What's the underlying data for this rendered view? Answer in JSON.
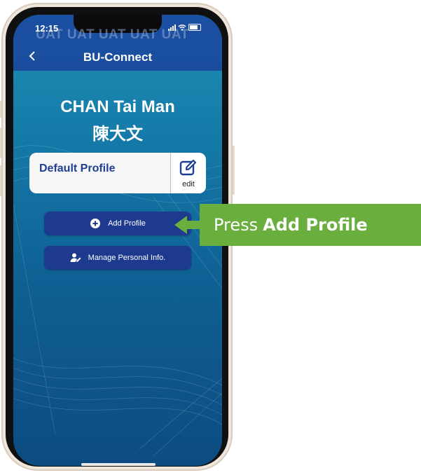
{
  "status_bar": {
    "time": "12:15",
    "watermark": "UAT UAT UAT UAT UAT"
  },
  "header": {
    "back_icon": "chevron-left-icon",
    "title": "BU-Connect"
  },
  "user": {
    "name_en": "CHAN Tai Man",
    "name_zh": "陳大文"
  },
  "profile_card": {
    "name": "Default Profile",
    "edit_label": "edit",
    "edit_icon": "pencil-square-icon"
  },
  "buttons": {
    "add_profile": {
      "label": "Add Profile",
      "icon": "plus-circle-icon"
    },
    "manage_info": {
      "label": "Manage Personal Info.",
      "icon": "user-edit-icon"
    }
  },
  "callout": {
    "prefix": "Press",
    "bold": "Add Profile"
  },
  "colors": {
    "header_blue": "#1b4fa2",
    "button_navy": "#1d3a8f",
    "callout_green": "#6aaf3d",
    "profile_text": "#1e3f93"
  }
}
